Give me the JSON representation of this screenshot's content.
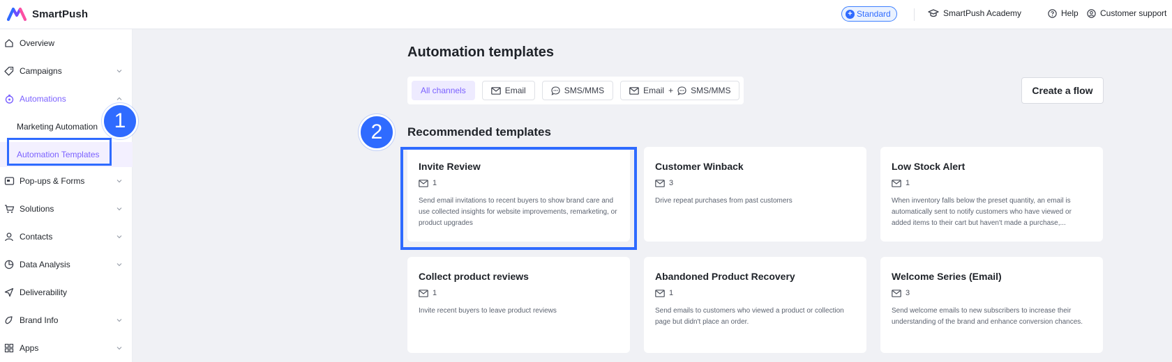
{
  "app": {
    "name": "SmartPush",
    "plan_badge": "Standard",
    "academy_link": "SmartPush Academy",
    "help_link": "Help",
    "support_link": "Customer support",
    "accent_color": "#7b61ff",
    "highlight_color": "#2f6bff"
  },
  "sidebar": {
    "items": [
      {
        "label": "Overview",
        "icon": "home-icon",
        "expandable": false
      },
      {
        "label": "Campaigns",
        "icon": "tag-icon",
        "expandable": true
      },
      {
        "label": "Automations",
        "icon": "automation-icon",
        "expandable": true,
        "expanded": true,
        "active": true
      },
      {
        "label": "Pop-ups & Forms",
        "icon": "popup-icon",
        "expandable": true
      },
      {
        "label": "Solutions",
        "icon": "cart-icon",
        "expandable": true
      },
      {
        "label": "Contacts",
        "icon": "user-icon",
        "expandable": true
      },
      {
        "label": "Data Analysis",
        "icon": "pie-chart-icon",
        "expandable": true
      },
      {
        "label": "Deliverability",
        "icon": "send-icon",
        "expandable": false
      },
      {
        "label": "Brand Info",
        "icon": "brand-icon",
        "expandable": true
      },
      {
        "label": "Apps",
        "icon": "apps-icon",
        "expandable": true
      }
    ],
    "subitems": [
      {
        "label": "Marketing Automation"
      },
      {
        "label": "Automation Templates",
        "selected": true
      }
    ]
  },
  "steps": {
    "one": "1",
    "two": "2"
  },
  "main": {
    "title": "Automation templates",
    "channels": [
      {
        "label": "All channels",
        "active": true
      },
      {
        "label": "Email"
      },
      {
        "label": "SMS/MMS"
      },
      {
        "label_a": "Email",
        "joiner": "+",
        "label_b": "SMS/MMS"
      }
    ],
    "create_button": "Create a flow",
    "section_title": "Recommended templates",
    "templates": [
      {
        "title": "Invite Review",
        "count": "1",
        "desc": "Send email invitations to recent buyers to show brand care and use collected insights for website improvements, remarketing, or product upgrades"
      },
      {
        "title": "Customer Winback",
        "count": "3",
        "desc": "Drive repeat purchases from past customers"
      },
      {
        "title": "Low Stock Alert",
        "count": "1",
        "desc": "When inventory falls below the preset quantity, an email is automatically sent to notify customers who have viewed or added items to their cart but haven't made a purchase,..."
      },
      {
        "title": "Collect product reviews",
        "count": "1",
        "desc": "Invite recent buyers to leave product reviews"
      },
      {
        "title": "Abandoned Product Recovery",
        "count": "1",
        "desc": "Send emails to customers who viewed a product or collection page but didn't place an order."
      },
      {
        "title": "Welcome Series (Email)",
        "count": "3",
        "desc": "Send welcome emails to new subscribers to increase their understanding of the brand and enhance conversion chances."
      }
    ]
  }
}
